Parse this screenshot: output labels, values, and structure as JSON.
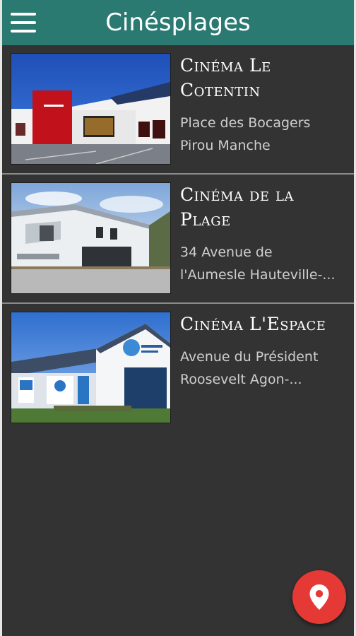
{
  "app": {
    "title": "Cinésplages",
    "accent_color": "#2a7a72",
    "background_color": "#333333",
    "fab_color": "#e53935"
  },
  "header": {
    "menu_icon": "hamburger-menu-icon"
  },
  "cinemas": [
    {
      "name_line1": "Cinéma Le",
      "name_line2": "Cotentin",
      "address_line1": "Place des Bocagers",
      "address_line2": "Pirou Manche"
    },
    {
      "name_line1": "Cinéma de la",
      "name_line2": "Plage",
      "address_line1": "34 Avenue de",
      "address_line2": "l'Aumesle Hauteville-..."
    },
    {
      "name_line1": "Cinéma L'Espace",
      "address_line1": "Avenue du Président",
      "address_line2": "Roosevelt Agon-..."
    }
  ],
  "fab": {
    "icon": "map-pin-icon"
  }
}
